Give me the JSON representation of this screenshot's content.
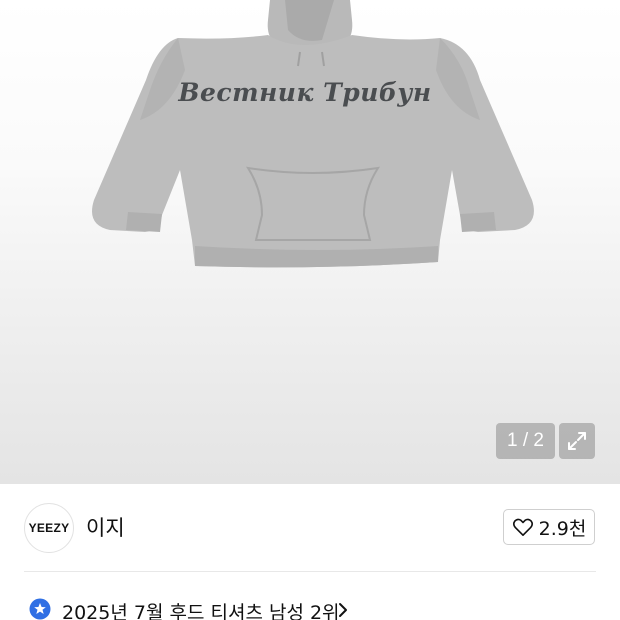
{
  "product_image": {
    "print_text": "Вестник Трибун",
    "page_counter": "1 / 2",
    "icons": {
      "expand": "expand-arrows-icon"
    }
  },
  "brand": {
    "logo_text": "YEEZY",
    "name": "이지",
    "like_count": "2.9천",
    "icons": {
      "like": "heart-outline-icon"
    }
  },
  "ranking": {
    "text": "2025년 7월 후드 티셔츠 남성 2위",
    "icons": {
      "badge": "star-badge-icon",
      "chevron": "chevron-right-icon"
    },
    "colors": {
      "badge": "#2f6fe4"
    }
  }
}
